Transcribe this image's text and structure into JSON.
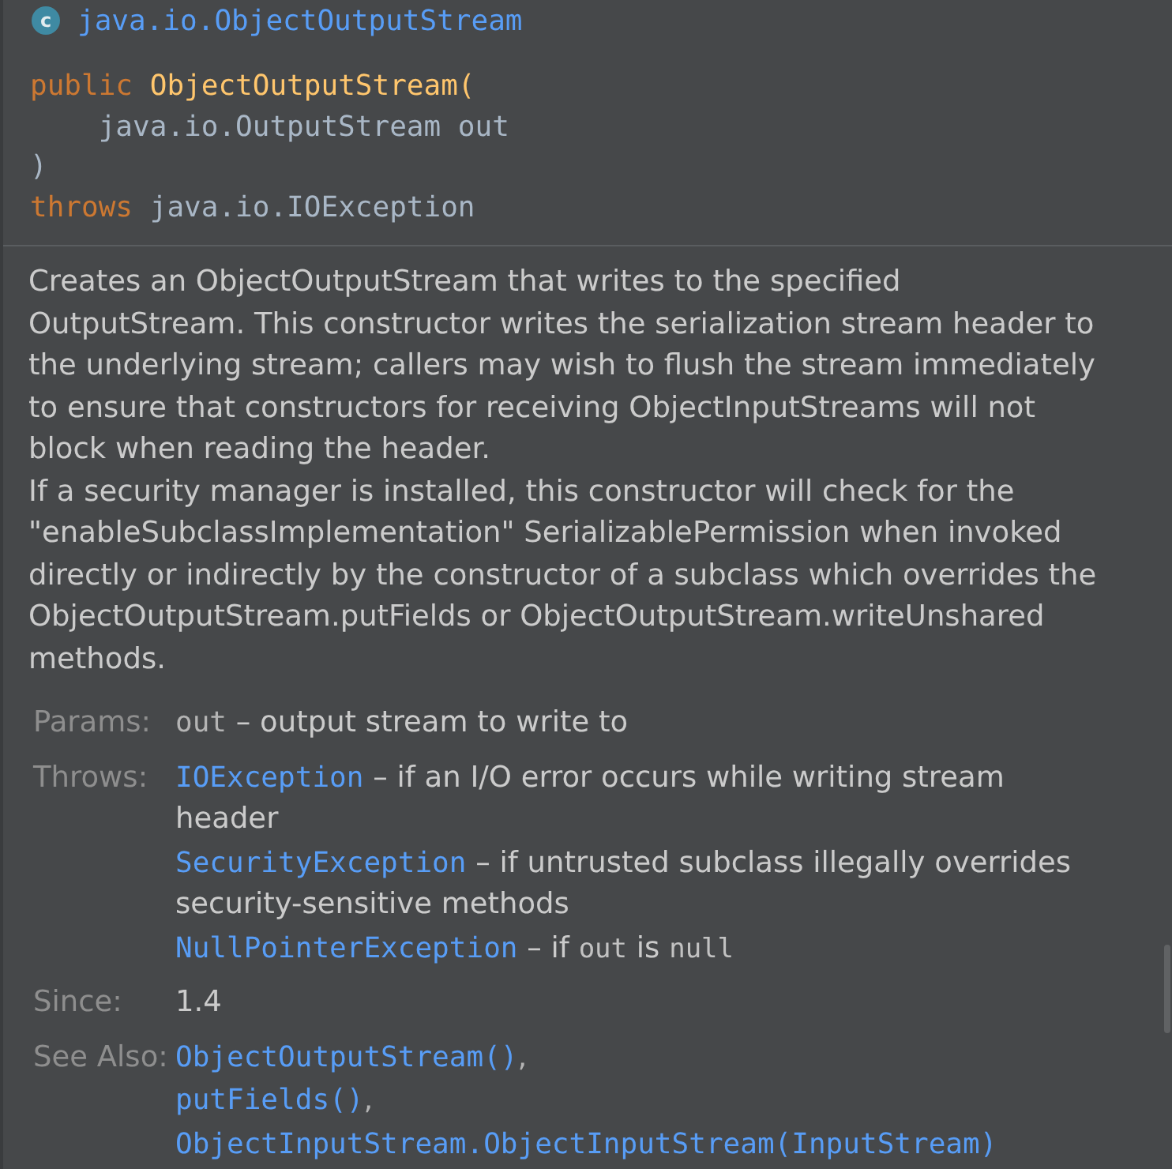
{
  "header": {
    "icon_letter": "c",
    "title": "java.io.ObjectOutputStream"
  },
  "signature": [
    {
      "indented": false,
      "tokens": [
        {
          "kind": "keyword",
          "text": "public"
        },
        {
          "kind": "name",
          "text": "ObjectOutputStream("
        }
      ]
    },
    {
      "indented": true,
      "tokens": [
        {
          "kind": "plain",
          "text": "java.io.OutputStream out"
        }
      ]
    },
    {
      "indented": false,
      "tokens": [
        {
          "kind": "plain",
          "text": ")"
        }
      ]
    },
    {
      "indented": false,
      "tokens": [
        {
          "kind": "keyword",
          "text": "throws"
        },
        {
          "kind": "plain",
          "text": "java.io.IOException"
        }
      ]
    }
  ],
  "description": [
    [
      "Creates an ObjectOutputStream that writes to the specified",
      "OutputStream. This constructor writes the serialization stream header to",
      "the underlying stream; callers may wish to flush the stream immediately",
      "to ensure that constructors for receiving ObjectInputStreams will not",
      "block when reading the header."
    ],
    [
      "If a security manager is installed, this constructor will check for the",
      "\"enableSubclassImplementation\" SerializablePermission when invoked",
      "directly or indirectly by the constructor of a subclass which overrides the",
      "ObjectOutputStream.putFields or ObjectOutputStream.writeUnshared",
      "methods."
    ]
  ],
  "tags": [
    {
      "label": "Params:",
      "entries": [
        {
          "term": {
            "kind": "code",
            "text": "out"
          },
          "description": [
            {
              "kind": "text",
              "text": "– output stream to write to"
            }
          ]
        }
      ]
    },
    {
      "label": "Throws:",
      "entries": [
        {
          "term": {
            "kind": "link",
            "text": "IOException"
          },
          "description": [
            {
              "kind": "text",
              "text": "– if an I/O error occurs while writing stream header"
            }
          ]
        },
        {
          "term": {
            "kind": "link",
            "text": "SecurityException"
          },
          "description": [
            {
              "kind": "text",
              "text": "– if untrusted subclass illegally overrides security-sensitive methods"
            }
          ]
        },
        {
          "term": {
            "kind": "link",
            "text": "NullPointerException"
          },
          "description": [
            {
              "kind": "text",
              "text": "– if "
            },
            {
              "kind": "code",
              "text": "out"
            },
            {
              "kind": "text",
              "text": " is "
            },
            {
              "kind": "code",
              "text": "null"
            }
          ]
        }
      ]
    },
    {
      "label": "Since:",
      "entries": [
        {
          "term": {
            "kind": "text",
            "text": "1.4"
          }
        }
      ]
    },
    {
      "label": "See Also:",
      "entries": [
        {
          "term": {
            "kind": "link",
            "text": "ObjectOutputStream()"
          },
          "suffix": ","
        },
        {
          "term": {
            "kind": "link",
            "text": "putFields()"
          },
          "suffix": ","
        },
        {
          "term": {
            "kind": "link",
            "text": "ObjectInputStream.ObjectInputStream(InputStream)"
          }
        }
      ]
    }
  ]
}
